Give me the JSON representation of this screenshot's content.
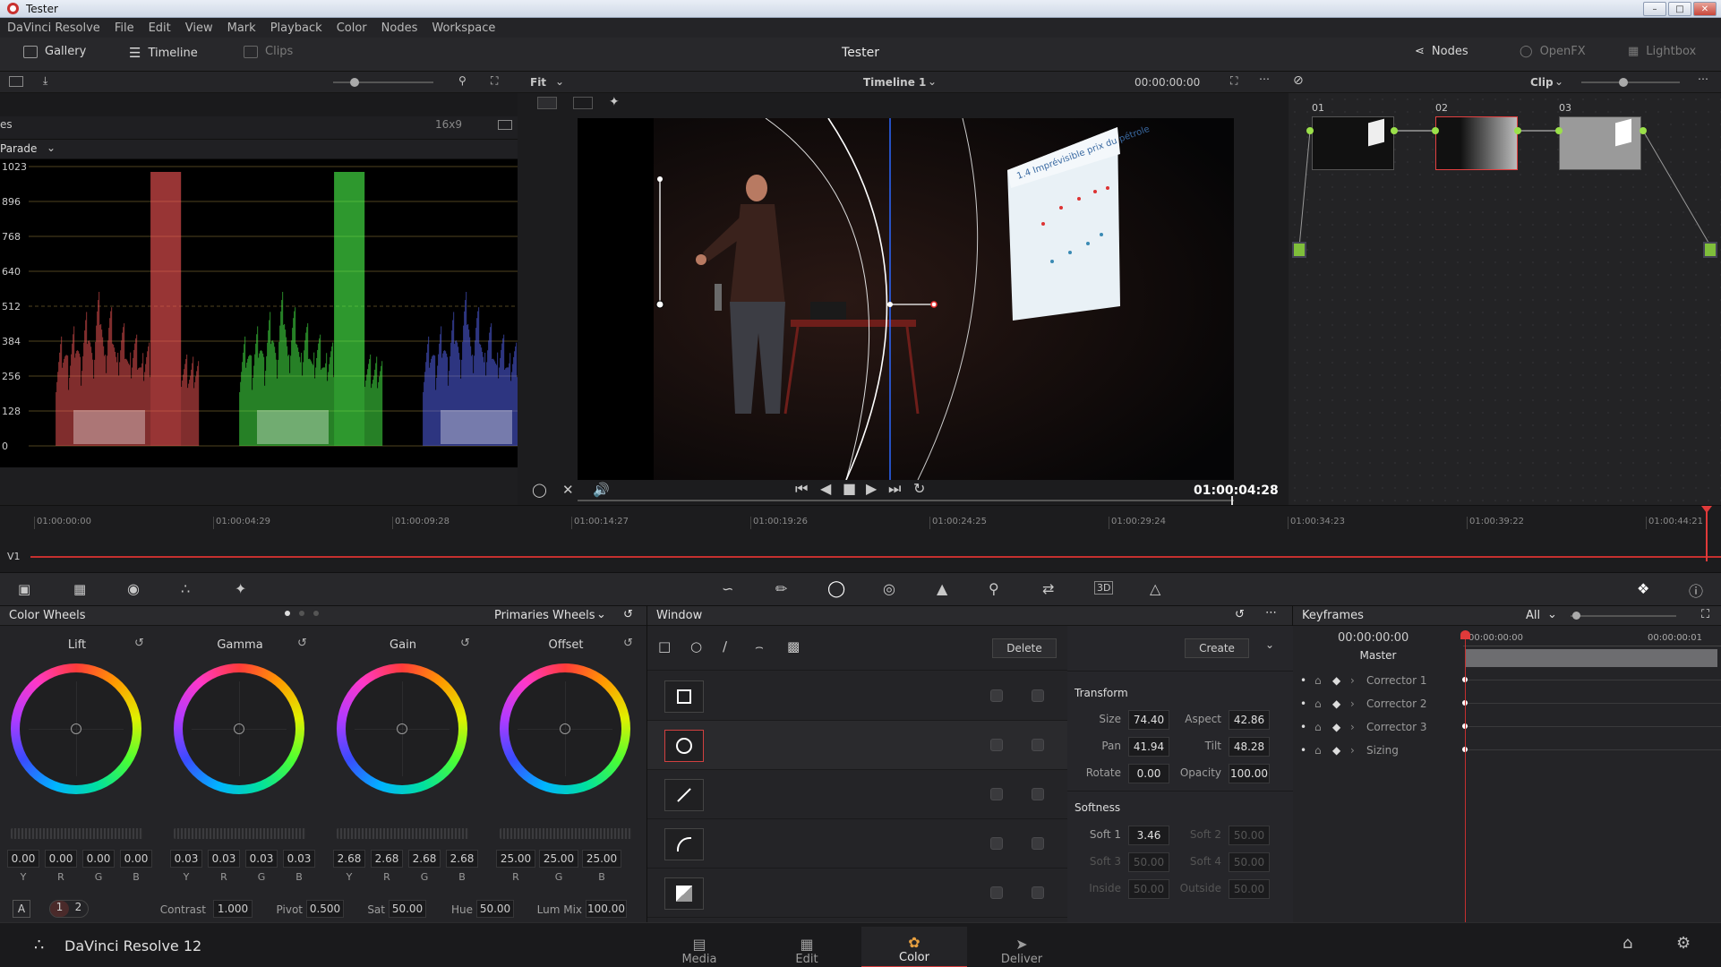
{
  "window": {
    "title": "Tester"
  },
  "menu": [
    "DaVinci Resolve",
    "File",
    "Edit",
    "View",
    "Mark",
    "Playback",
    "Color",
    "Nodes",
    "Workspace"
  ],
  "toolbar": {
    "gallery": "Gallery",
    "timeline": "Timeline",
    "clips": "Clips",
    "project_title": "Tester",
    "nodes": "Nodes",
    "openfx": "OpenFX",
    "lightbox": "Lightbox"
  },
  "viewer_bar": {
    "zoom": "Fit",
    "timeline_name": "Timeline 1",
    "timecode": "00:00:00:00",
    "clip_mode": "Clip"
  },
  "scopes": {
    "title": "es",
    "aspect": "16x9",
    "mode": "Parade",
    "y_ticks": [
      "1023",
      "896",
      "768",
      "640",
      "512",
      "384",
      "256",
      "128",
      "0"
    ]
  },
  "viewer": {
    "timecode": "01:00:04:28",
    "slide_text": "1.4 Imprévisible prix du pétrole"
  },
  "nodes": [
    {
      "id": "01"
    },
    {
      "id": "02"
    },
    {
      "id": "03"
    }
  ],
  "timeline": {
    "track": "V1",
    "marks": [
      "01:00:00:00",
      "01:00:04:29",
      "01:00:09:28",
      "01:00:14:27",
      "01:00:19:26",
      "01:00:24:25",
      "01:00:29:24",
      "01:00:34:23",
      "01:00:39:22",
      "01:00:44:21"
    ]
  },
  "colorwheels": {
    "title": "Color Wheels",
    "mode": "Primaries Wheels",
    "wheels": [
      {
        "name": "Lift",
        "values": [
          "0.00",
          "0.00",
          "0.00",
          "0.00"
        ],
        "channels": [
          "Y",
          "R",
          "G",
          "B"
        ]
      },
      {
        "name": "Gamma",
        "values": [
          "0.03",
          "0.03",
          "0.03",
          "0.03"
        ],
        "channels": [
          "Y",
          "R",
          "G",
          "B"
        ]
      },
      {
        "name": "Gain",
        "values": [
          "2.68",
          "2.68",
          "2.68",
          "2.68"
        ],
        "channels": [
          "Y",
          "R",
          "G",
          "B"
        ]
      },
      {
        "name": "Offset",
        "values": [
          "25.00",
          "25.00",
          "25.00"
        ],
        "channels": [
          "R",
          "G",
          "B"
        ]
      }
    ],
    "footer": {
      "a": "A",
      "p1": "1",
      "p2": "2",
      "contrast_label": "Contrast",
      "contrast": "1.000",
      "pivot_label": "Pivot",
      "pivot": "0.500",
      "sat_label": "Sat",
      "sat": "50.00",
      "hue_label": "Hue",
      "hue": "50.00",
      "lummix_label": "Lum Mix",
      "lummix": "100.00"
    }
  },
  "windowpanel": {
    "title": "Window",
    "delete": "Delete",
    "create": "Create",
    "transform": {
      "title": "Transform",
      "size_label": "Size",
      "size": "74.40",
      "aspect_label": "Aspect",
      "aspect": "42.86",
      "pan_label": "Pan",
      "pan": "41.94",
      "tilt_label": "Tilt",
      "tilt": "48.28",
      "rotate_label": "Rotate",
      "rotate": "0.00",
      "opacity_label": "Opacity",
      "opacity": "100.00"
    },
    "softness": {
      "title": "Softness",
      "soft1_label": "Soft 1",
      "soft1": "3.46",
      "soft2_label": "Soft 2",
      "soft2": "50.00",
      "soft3_label": "Soft 3",
      "soft3": "50.00",
      "soft4_label": "Soft 4",
      "soft4": "50.00",
      "inside_label": "Inside",
      "inside": "50.00",
      "outside_label": "Outside",
      "outside": "50.00"
    }
  },
  "keyframes": {
    "title": "Keyframes",
    "filter": "All",
    "timecode": "00:00:00:00",
    "ruler_start": "00:00:00:00",
    "ruler_end": "00:00:00:01",
    "master": "Master",
    "rows": [
      "Corrector 1",
      "Corrector 2",
      "Corrector 3",
      "Sizing"
    ]
  },
  "bottombar": {
    "app": "DaVinci Resolve 12",
    "pages": [
      "Media",
      "Edit",
      "Color",
      "Deliver"
    ],
    "active": "Color"
  }
}
